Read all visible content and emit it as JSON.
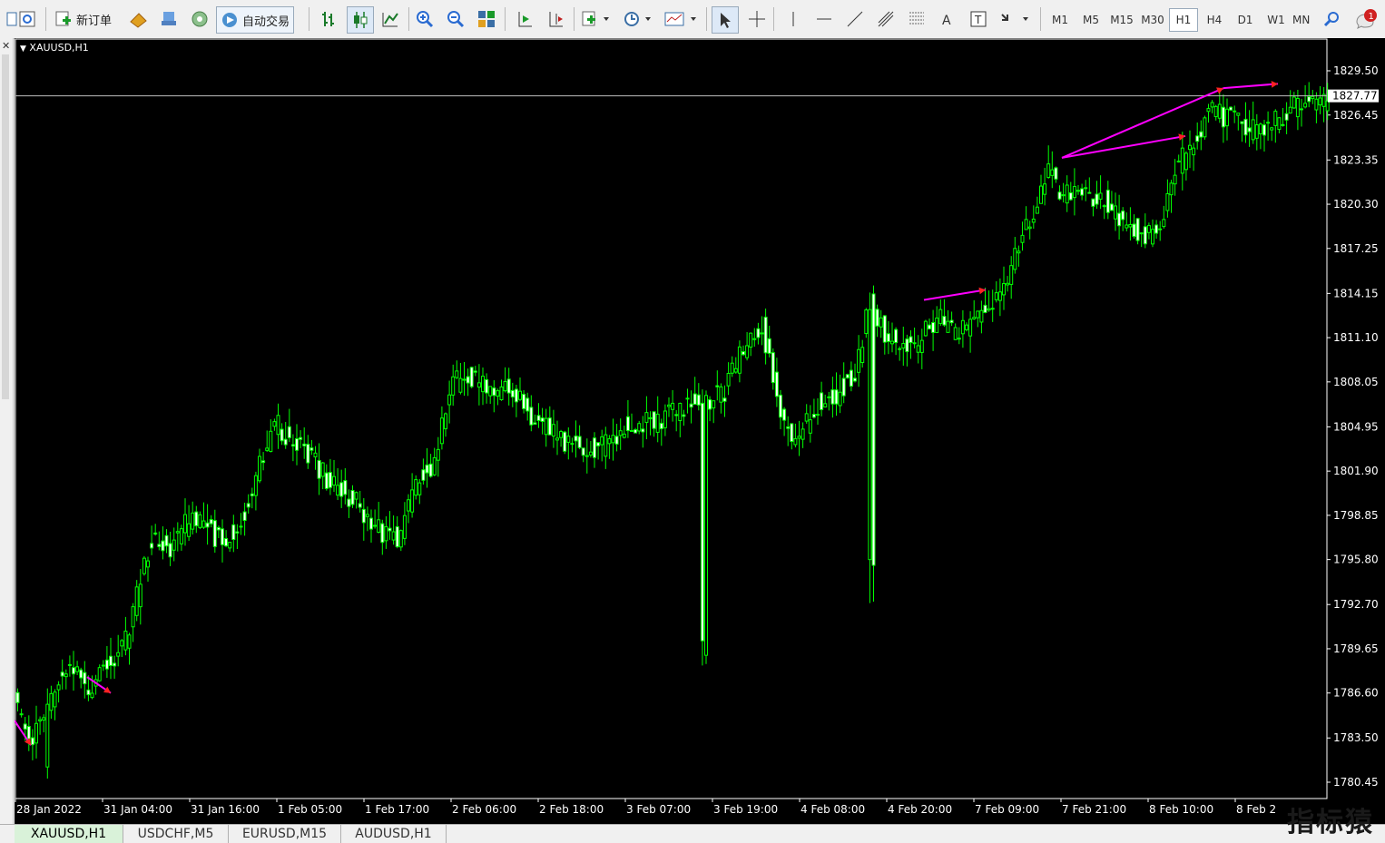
{
  "toolbar": {
    "new_order_label": "新订单",
    "auto_trade_label": "自动交易",
    "timeframes": [
      "M1",
      "M5",
      "M15",
      "M30",
      "H1",
      "H4",
      "D1",
      "W1",
      "MN"
    ],
    "active_timeframe": "H1",
    "notification_count": "1"
  },
  "chart": {
    "title": "XAUUSD,H1",
    "current_price": "1827.77",
    "price_labels": [
      "1829.50",
      "1826.45",
      "1823.35",
      "1820.30",
      "1817.25",
      "1814.15",
      "1811.10",
      "1808.05",
      "1804.95",
      "1801.90",
      "1798.85",
      "1795.80",
      "1792.70",
      "1789.65",
      "1786.60",
      "1783.50",
      "1780.45"
    ],
    "time_labels": [
      "28 Jan 2022",
      "31 Jan 04:00",
      "31 Jan 16:00",
      "1 Feb 05:00",
      "1 Feb 17:00",
      "2 Feb 06:00",
      "2 Feb 18:00",
      "3 Feb 07:00",
      "3 Feb 19:00",
      "4 Feb 08:00",
      "4 Feb 20:00",
      "7 Feb 09:00",
      "7 Feb 21:00",
      "8 Feb 10:00",
      "8 Feb 2"
    ],
    "colors": {
      "background": "#000000",
      "bull": "#00ff00",
      "bear_body": "#ffffff",
      "arrow": "#ff00ff",
      "arrow_head": "#ff2222"
    }
  },
  "tabs": [
    {
      "label": "XAUUSD,H1",
      "active": true
    },
    {
      "label": "USDCHF,M5",
      "active": false
    },
    {
      "label": "EURUSD,M15",
      "active": false
    },
    {
      "label": "AUDUSD,H1",
      "active": false
    }
  ],
  "watermark": "指标猿"
}
